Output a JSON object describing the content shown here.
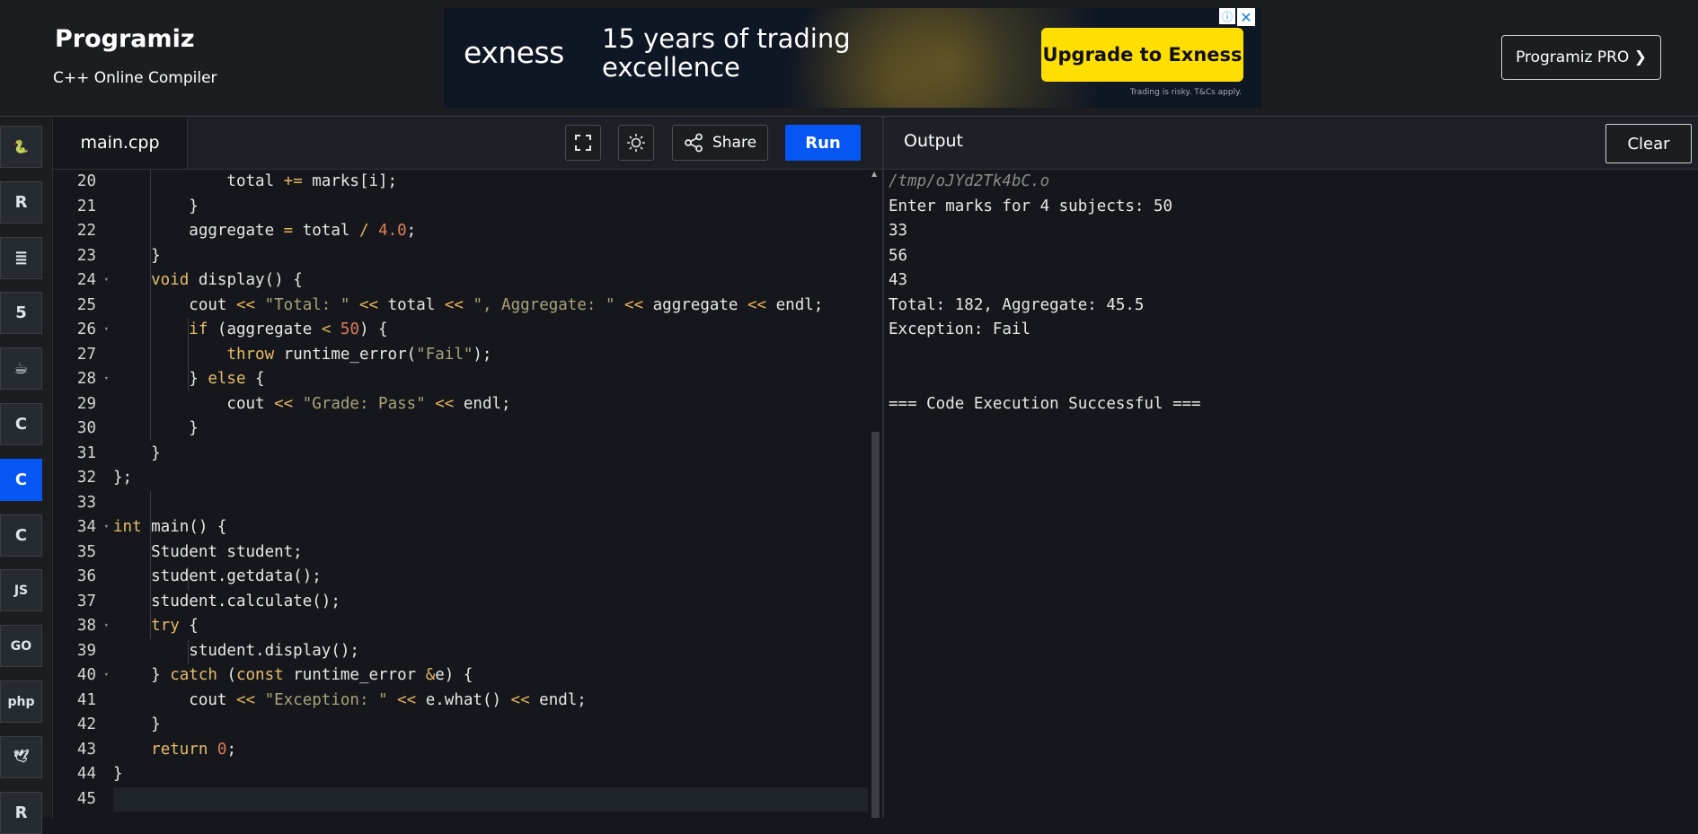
{
  "brand": {
    "logo": "Programiz",
    "subtitle": "C++ Online Compiler",
    "pro_label": "Programiz PRO ❯"
  },
  "ad": {
    "logo": "exness",
    "headline": "15 years of trading excellence",
    "cta": "Upgrade to Exness",
    "disclaimer": "Trading is risky. T&Cs apply.",
    "info_icon": "ⓘ",
    "close_icon": "✕"
  },
  "sidebar": {
    "languages": [
      {
        "name": "Python",
        "icon": "python-icon",
        "glyph": "🐍",
        "active": false
      },
      {
        "name": "R",
        "icon": "r-icon",
        "glyph": "R",
        "active": false
      },
      {
        "name": "SQL",
        "icon": "database-icon",
        "glyph": "≣",
        "active": false
      },
      {
        "name": "HTML",
        "icon": "html5-icon",
        "glyph": "5",
        "active": false
      },
      {
        "name": "Java",
        "icon": "java-icon",
        "glyph": "☕",
        "active": false
      },
      {
        "name": "C",
        "icon": "c-icon",
        "glyph": "C",
        "active": false
      },
      {
        "name": "C++",
        "icon": "cpp-icon",
        "glyph": "C",
        "active": true
      },
      {
        "name": "C#",
        "icon": "csharp-icon",
        "glyph": "C",
        "active": false
      },
      {
        "name": "JavaScript",
        "icon": "js-icon",
        "glyph": "JS",
        "active": false
      },
      {
        "name": "Go",
        "icon": "go-icon",
        "glyph": "GO",
        "active": false
      },
      {
        "name": "PHP",
        "icon": "php-icon",
        "glyph": "php",
        "active": false
      },
      {
        "name": "Swift",
        "icon": "swift-icon",
        "glyph": "🕊",
        "active": false
      },
      {
        "name": "Rust",
        "icon": "rust-icon",
        "glyph": "R",
        "active": false
      }
    ]
  },
  "editor": {
    "tab": "main.cpp",
    "share_label": "Share",
    "run_label": "Run",
    "line_numbers": [
      "20",
      "21",
      "22",
      "23",
      "24",
      "25",
      "26",
      "27",
      "28",
      "29",
      "30",
      "31",
      "32",
      "33",
      "34",
      "35",
      "36",
      "37",
      "38",
      "39",
      "40",
      "41",
      "42",
      "43",
      "44",
      "45"
    ],
    "fold_lines": [
      "24",
      "26",
      "28",
      "34",
      "38",
      "40"
    ],
    "lines": [
      [
        [
          "",
          "        total "
        ],
        [
          "op",
          "+="
        ],
        [
          "",
          " marks[i];"
        ]
      ],
      [
        [
          "",
          "    }"
        ]
      ],
      [
        [
          "",
          "    aggregate "
        ],
        [
          "op",
          "="
        ],
        [
          "",
          " total "
        ],
        [
          "op",
          "/"
        ],
        [
          "",
          " "
        ],
        [
          "num",
          "4.0"
        ],
        [
          "",
          ";"
        ]
      ],
      [
        [
          "",
          "}"
        ]
      ],
      [
        [
          "kw",
          "void"
        ],
        [
          "",
          " display() {"
        ]
      ],
      [
        [
          "",
          "    cout "
        ],
        [
          "op",
          "<<"
        ],
        [
          "",
          " "
        ],
        [
          "str",
          "\"Total: \""
        ],
        [
          "",
          " "
        ],
        [
          "op",
          "<<"
        ],
        [
          "",
          " total "
        ],
        [
          "op",
          "<<"
        ],
        [
          "",
          " "
        ],
        [
          "str",
          "\", Aggregate: \""
        ],
        [
          "",
          " "
        ],
        [
          "op",
          "<<"
        ],
        [
          "",
          " aggregate "
        ],
        [
          "op",
          "<<"
        ],
        [
          "",
          " endl;"
        ]
      ],
      [
        [
          "",
          "    "
        ],
        [
          "kw",
          "if"
        ],
        [
          "",
          " (aggregate "
        ],
        [
          "op",
          "<"
        ],
        [
          "",
          " "
        ],
        [
          "num",
          "50"
        ],
        [
          "",
          ") {"
        ]
      ],
      [
        [
          "",
          "        "
        ],
        [
          "kw",
          "throw"
        ],
        [
          "",
          " runtime_error("
        ],
        [
          "str",
          "\"Fail\""
        ],
        [
          "",
          ");"
        ]
      ],
      [
        [
          "",
          "    } "
        ],
        [
          "kw",
          "else"
        ],
        [
          "",
          " {"
        ]
      ],
      [
        [
          "",
          "        cout "
        ],
        [
          "op",
          "<<"
        ],
        [
          "",
          " "
        ],
        [
          "str",
          "\"Grade: Pass\""
        ],
        [
          "",
          " "
        ],
        [
          "op",
          "<<"
        ],
        [
          "",
          " endl;"
        ]
      ],
      [
        [
          "",
          "    }"
        ]
      ],
      [
        [
          "",
          "}"
        ]
      ],
      [
        [
          "",
          "};"
        ]
      ],
      [
        [
          "",
          ""
        ]
      ],
      [
        [
          "kw",
          "int"
        ],
        [
          "",
          " main() {"
        ]
      ],
      [
        [
          "",
          "    Student student;"
        ]
      ],
      [
        [
          "",
          "    student.getdata();"
        ]
      ],
      [
        [
          "",
          "    student.calculate();"
        ]
      ],
      [
        [
          "",
          "    "
        ],
        [
          "kw",
          "try"
        ],
        [
          "",
          " {"
        ]
      ],
      [
        [
          "",
          "        student.display();"
        ]
      ],
      [
        [
          "",
          "    } "
        ],
        [
          "kw",
          "catch"
        ],
        [
          "",
          " ("
        ],
        [
          "kw",
          "const"
        ],
        [
          "",
          " runtime_error "
        ],
        [
          "op",
          "&"
        ],
        [
          "",
          "e) {"
        ]
      ],
      [
        [
          "",
          "        cout "
        ],
        [
          "op",
          "<<"
        ],
        [
          "",
          " "
        ],
        [
          "str",
          "\"Exception: \""
        ],
        [
          "",
          " "
        ],
        [
          "op",
          "<<"
        ],
        [
          "",
          " e.what() "
        ],
        [
          "op",
          "<<"
        ],
        [
          "",
          " endl;"
        ]
      ],
      [
        [
          "",
          "    }"
        ]
      ],
      [
        [
          "",
          "    "
        ],
        [
          "kw",
          "return"
        ],
        [
          "",
          " "
        ],
        [
          "num",
          "0"
        ],
        [
          "",
          ";"
        ]
      ],
      [
        [
          "",
          "}"
        ]
      ],
      [
        [
          "",
          ""
        ]
      ]
    ],
    "line_indents": [
      1,
      1,
      1,
      1,
      1,
      1,
      1,
      1,
      1,
      1,
      1,
      1,
      0,
      0,
      0,
      0,
      0,
      0,
      0,
      0,
      0,
      0,
      0,
      0,
      0,
      0
    ]
  },
  "output": {
    "title": "Output",
    "clear_label": "Clear",
    "path": "/tmp/oJYd2Tk4bC.o",
    "lines": [
      "Enter marks for 4 subjects: 50",
      "33",
      "56",
      "43",
      "Total: 182, Aggregate: 45.5",
      "Exception: Fail",
      "",
      "",
      "=== Code Execution Successful ==="
    ]
  }
}
